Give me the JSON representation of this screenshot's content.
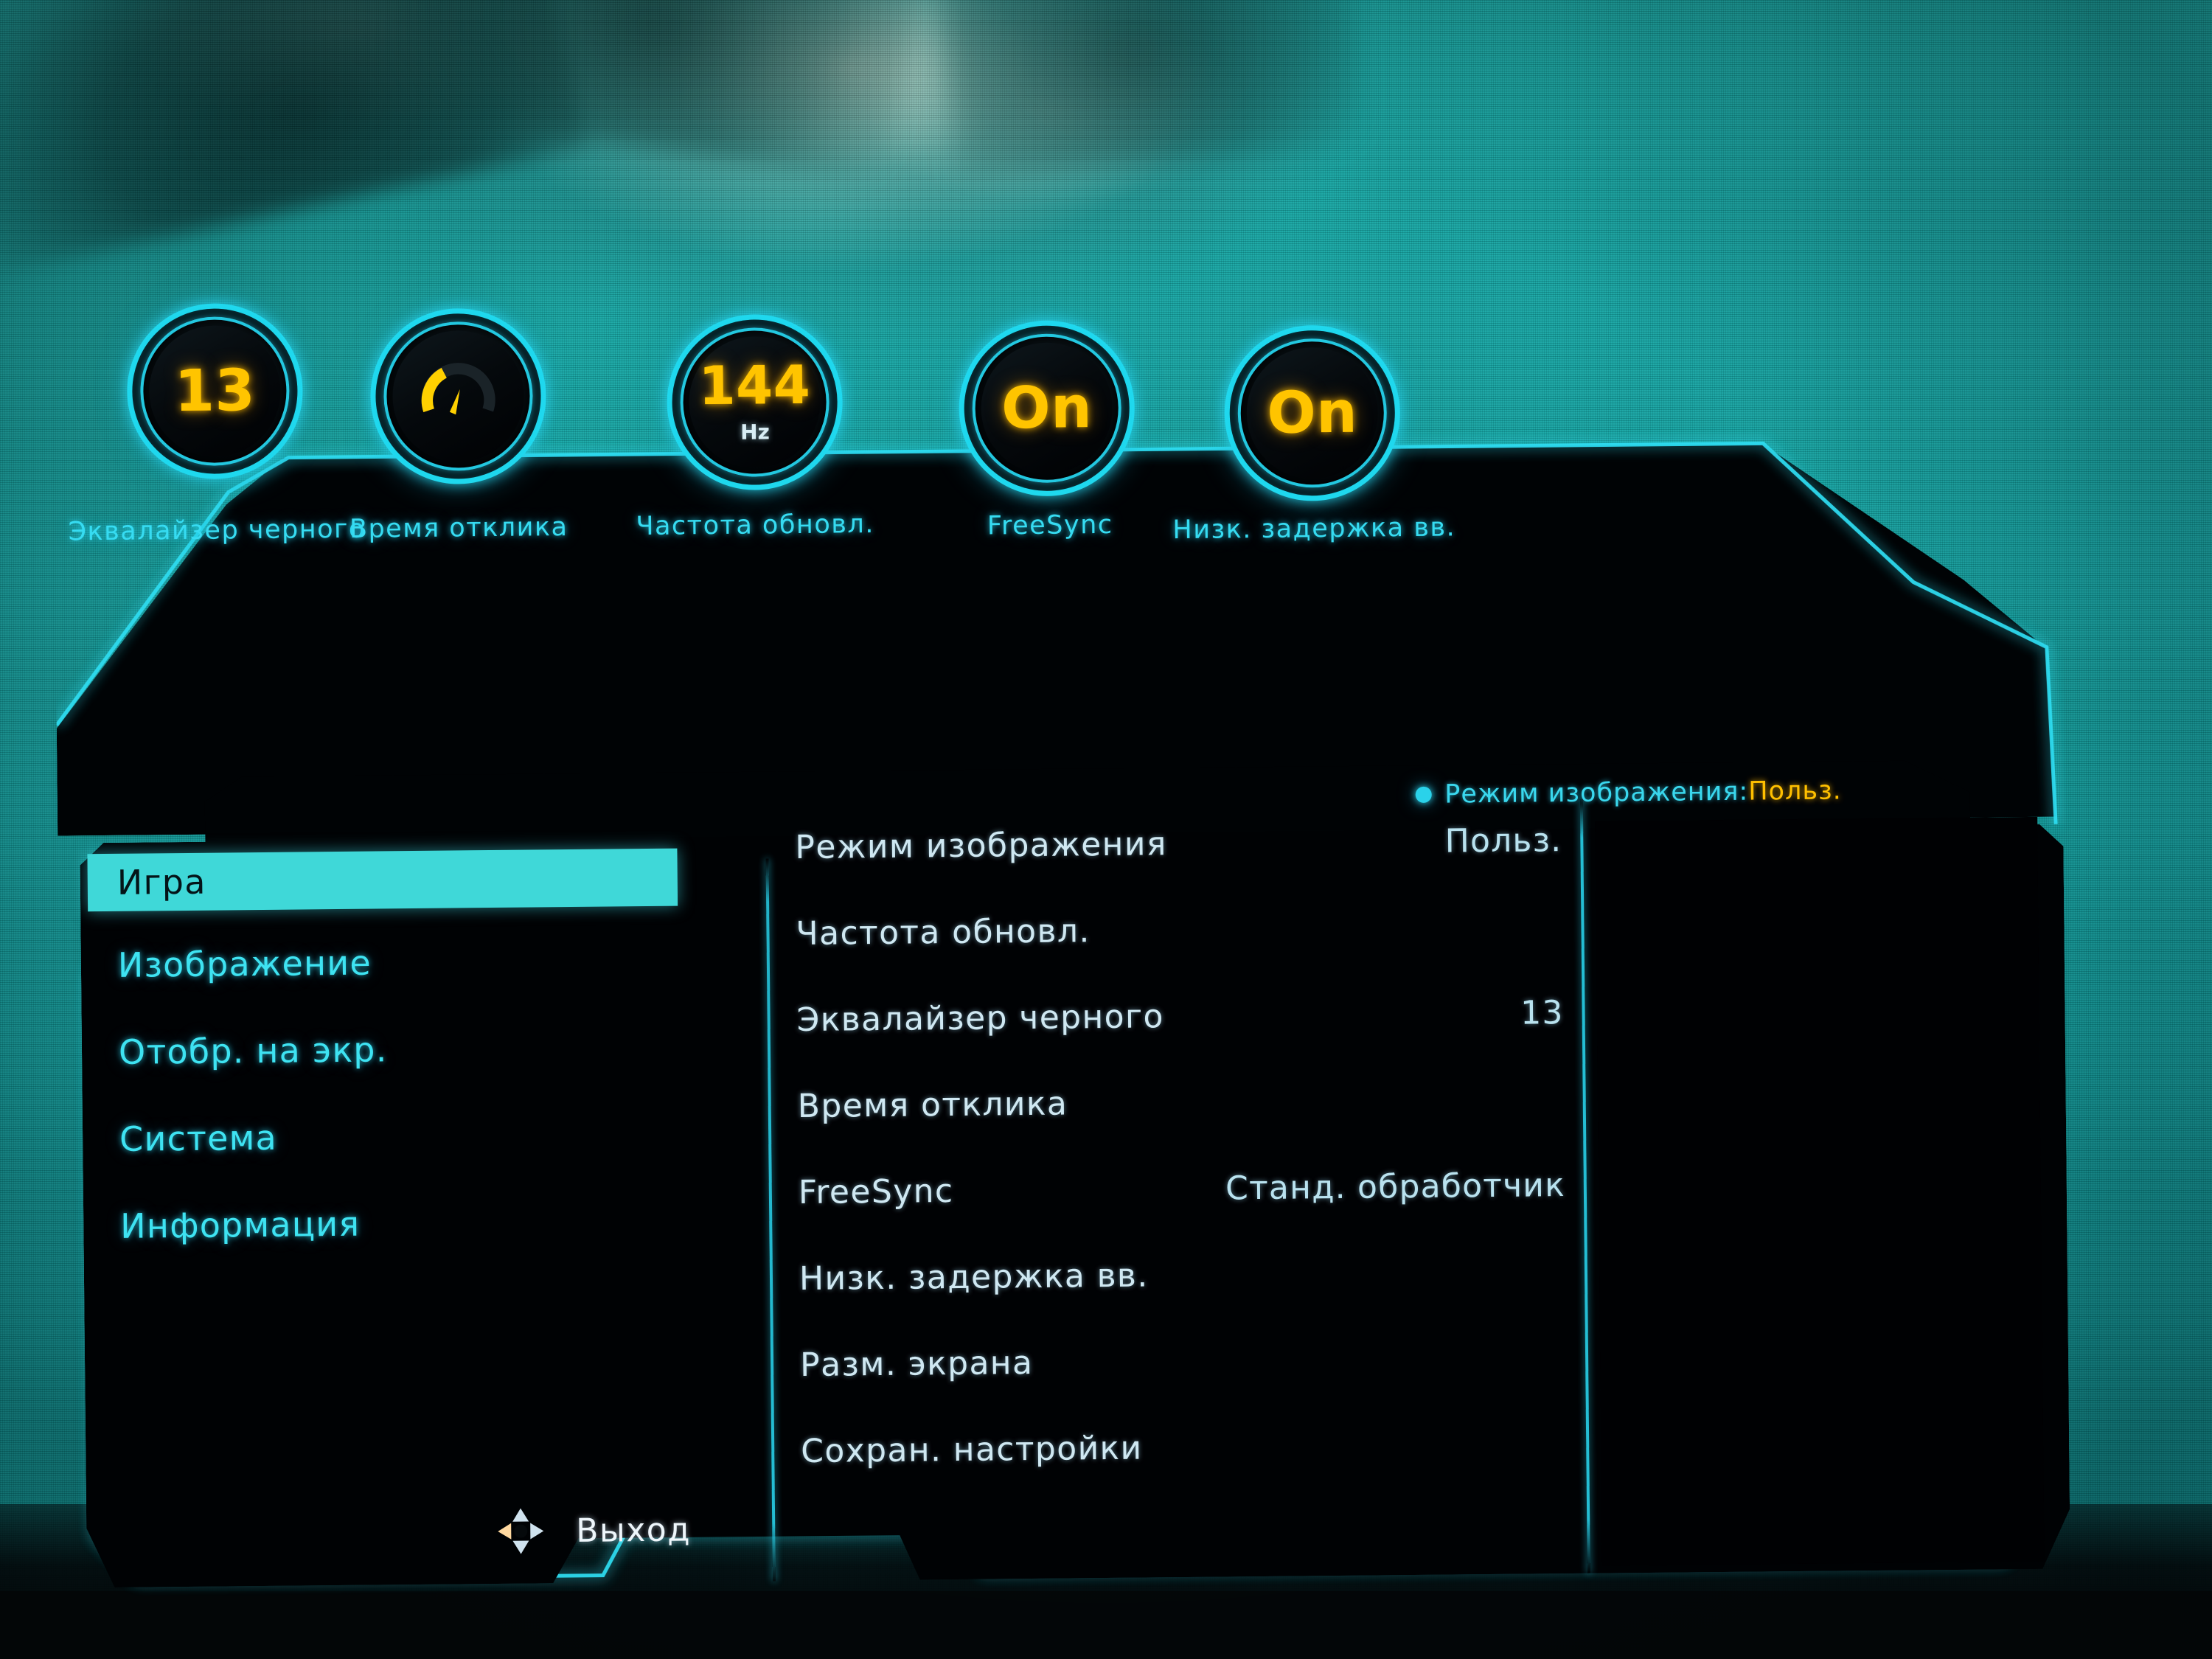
{
  "osd": {
    "brand_accent": "#2ad2ea",
    "value_accent": "#ffc400",
    "highlight_bg": "#3fd8d8"
  },
  "gauges": [
    {
      "label": "Эквалайзер черного",
      "value": "13",
      "unit": "",
      "icon": "number-gauge-icon"
    },
    {
      "label": "Время отклика",
      "value": "",
      "unit": "",
      "icon": "speedometer-icon"
    },
    {
      "label": "Частота обновл.",
      "value": "144",
      "unit": "Hz",
      "icon": "number-gauge-icon"
    },
    {
      "label": "FreeSync",
      "value": "On",
      "unit": "",
      "icon": "toggle-gauge-icon"
    },
    {
      "label": "Низк. задержка вв.",
      "value": "On",
      "unit": "",
      "icon": "toggle-gauge-icon"
    }
  ],
  "status": {
    "dot_icon": "status-dot-icon",
    "label": "Режим изображения:",
    "value": "Польз."
  },
  "sidebar": {
    "items": [
      {
        "label": "Игра",
        "active": true
      },
      {
        "label": "Изображение",
        "active": false
      },
      {
        "label": "Отобр. на экр.",
        "active": false
      },
      {
        "label": "Система",
        "active": false
      },
      {
        "label": "Информация",
        "active": false
      }
    ]
  },
  "exit": {
    "icon": "dpad-navigation-icon",
    "label": "Выход"
  },
  "options": [
    {
      "name": "Режим изображения",
      "value": "Польз."
    },
    {
      "name": "Частота обновл.",
      "value": ""
    },
    {
      "name": "Эквалайзер черного",
      "value": "13"
    },
    {
      "name": "Время отклика",
      "value": ""
    },
    {
      "name": "FreeSync",
      "value": "Станд. обработчик"
    },
    {
      "name": "Низк. задержка вв.",
      "value": ""
    },
    {
      "name": "Разм. экрана",
      "value": ""
    },
    {
      "name": "Сохран. настройки",
      "value": ""
    }
  ]
}
